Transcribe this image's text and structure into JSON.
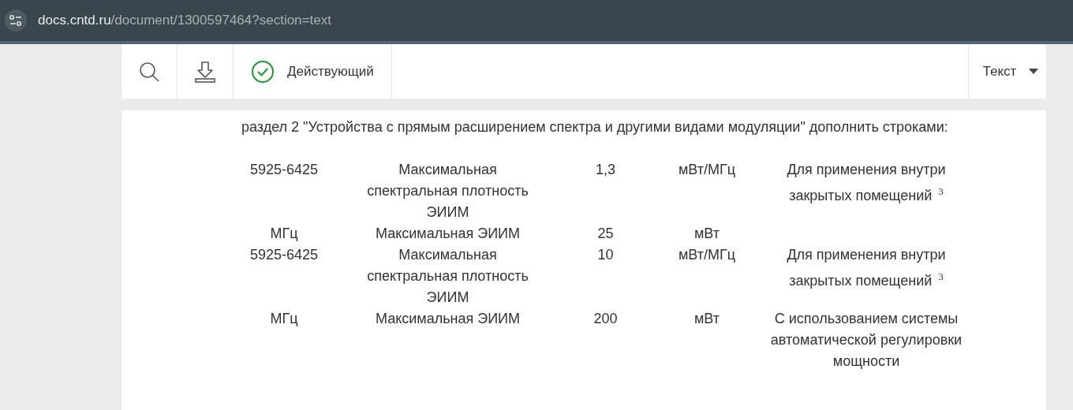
{
  "browser": {
    "url_host": "docs.cntd.ru",
    "url_path": "/document/1300597464?section=text"
  },
  "toolbar": {
    "status": "Действующий",
    "view": "Текст"
  },
  "paragraph": "раздел 2 \"Устройства с прямым расширением спектра и другими видами модуляции\" дополнить строками:",
  "table": {
    "rows": [
      {
        "cells": [
          "5925-6425",
          "Максимальная спектральная плотность ЭИИМ",
          "1,3",
          "мВт/МГц",
          "Для применения внутри закрытых помещений $^{3}$"
        ]
      },
      {
        "cells": [
          "МГц",
          "Максимальная ЭИИМ",
          "25",
          "мВт",
          ""
        ]
      },
      {
        "cells": [
          "5925-6425",
          "Максимальная спектральная плотность ЭИИМ",
          "10",
          "мВт/МГц",
          "Для применения внутри закрытых помещений $^{3}$"
        ]
      },
      {
        "cells": [
          "МГц",
          "Максимальная ЭИИМ",
          "200",
          "мВт",
          "С использованием системы автоматической регулировки мощности"
        ]
      }
    ]
  }
}
